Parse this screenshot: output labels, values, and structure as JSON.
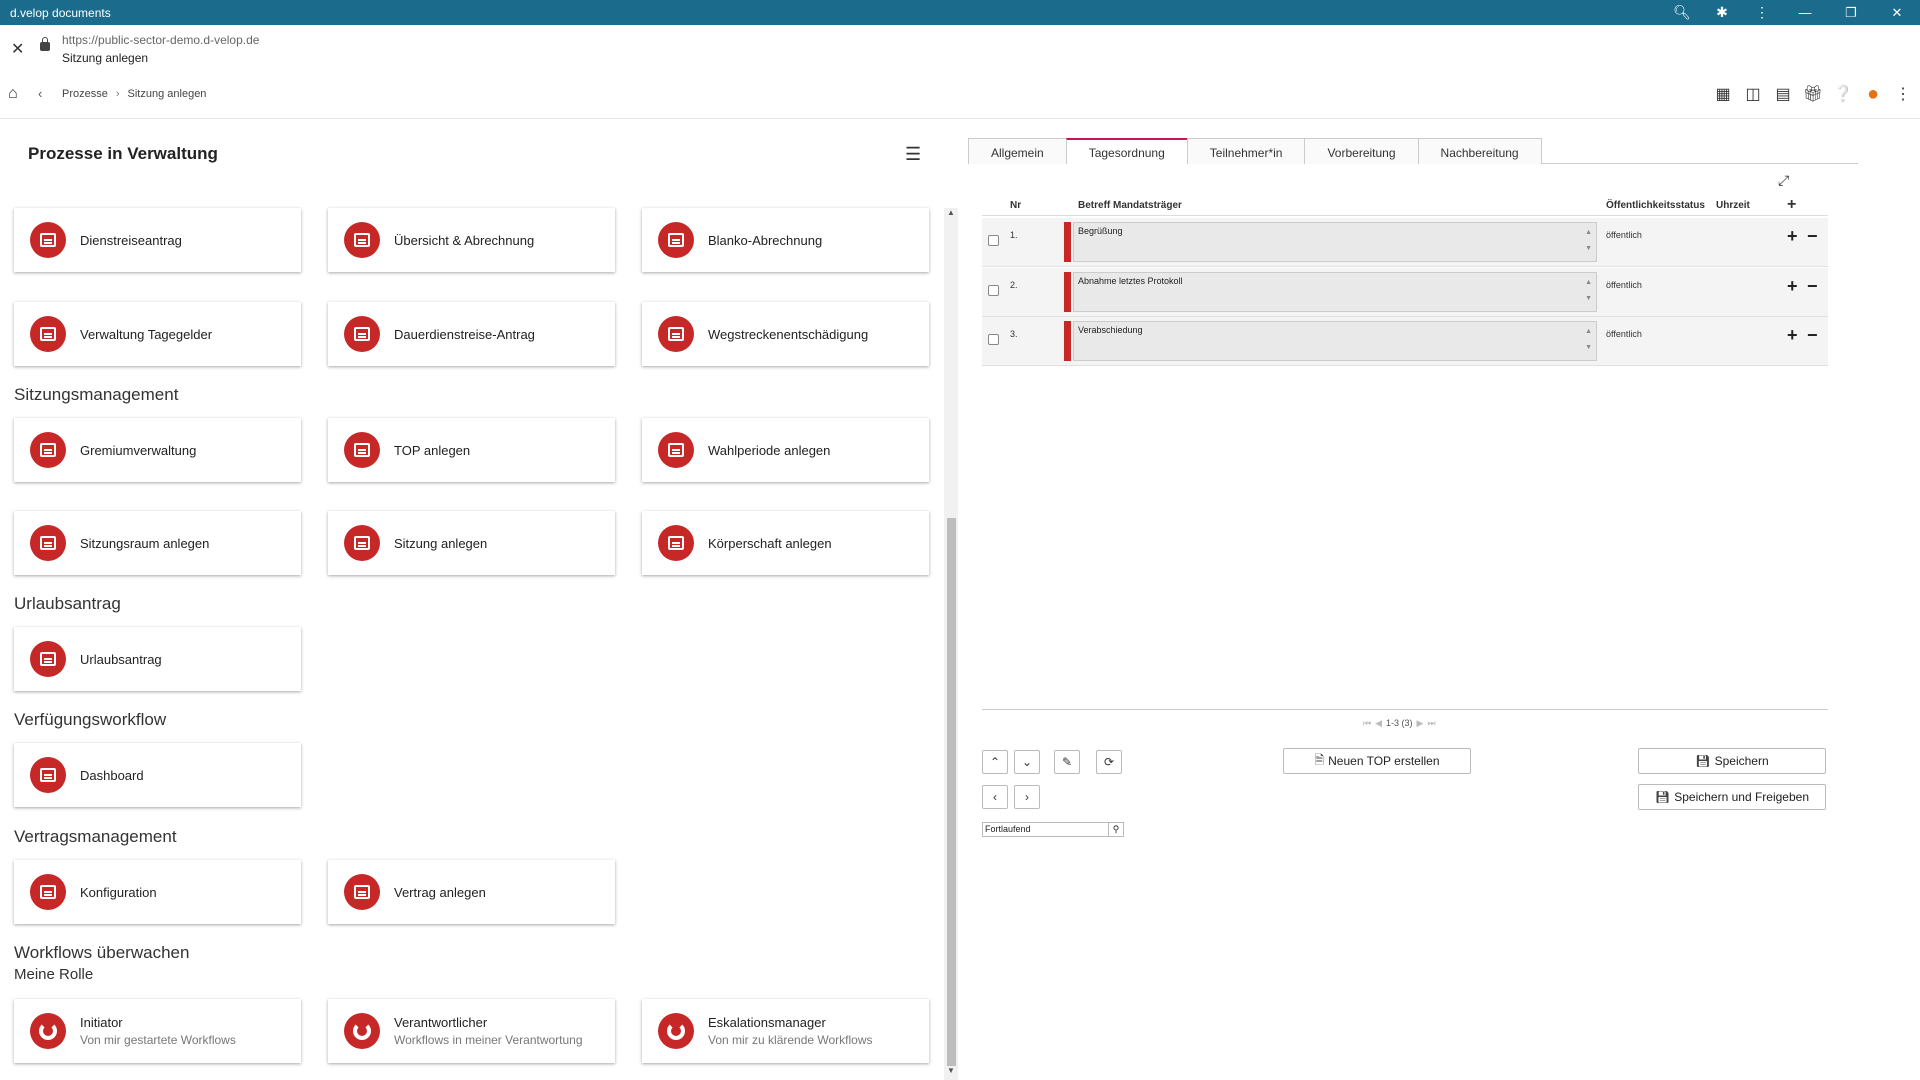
{
  "window": {
    "title": "d.velop documents"
  },
  "urlbar": {
    "url": "https://public-sector-demo.d-velop.de",
    "page_title": "Sitzung anlegen"
  },
  "breadcrumb": {
    "items": [
      "Prozesse",
      "Sitzung anlegen"
    ]
  },
  "left": {
    "title": "Prozesse in Verwaltung",
    "tiles": [
      {
        "label": "Dienstreiseantrag"
      },
      {
        "label": "Übersicht & Abrechnung"
      },
      {
        "label": "Blanko-Abrechnung"
      },
      {
        "label": "Verwaltung Tagegelder"
      },
      {
        "label": "Dauerdienstreise-Antrag"
      },
      {
        "label": "Wegstreckenentschädigung"
      }
    ],
    "sections": [
      {
        "title": "Sitzungsmanagement",
        "tiles": [
          {
            "label": "Gremiumverwaltung"
          },
          {
            "label": "TOP anlegen"
          },
          {
            "label": "Wahlperiode anlegen"
          },
          {
            "label": "Sitzungsraum anlegen"
          },
          {
            "label": "Sitzung anlegen"
          },
          {
            "label": "Körperschaft anlegen"
          }
        ]
      },
      {
        "title": "Urlaubsantrag",
        "tiles": [
          {
            "label": "Urlaubsantrag"
          }
        ]
      },
      {
        "title": "Verfügungsworkflow",
        "tiles": [
          {
            "label": "Dashboard"
          }
        ]
      },
      {
        "title": "Vertragsmanagement",
        "tiles": [
          {
            "label": "Konfiguration"
          },
          {
            "label": "Vertrag anlegen"
          }
        ]
      },
      {
        "title": "Workflows überwachen",
        "subtitle": "Meine Rolle",
        "tiles": [
          {
            "label": "Initiator",
            "sub": "Von mir gestartete Workflows"
          },
          {
            "label": "Verantwortlicher",
            "sub": "Workflows in meiner Verantwortung"
          },
          {
            "label": "Eskalationsmanager",
            "sub": "Von mir zu klärende Workflows"
          }
        ]
      }
    ]
  },
  "right": {
    "tabs": [
      "Allgemein",
      "Tagesordnung",
      "Teilnehmer*in",
      "Vorbereitung",
      "Nachbereitung"
    ],
    "active_tab": "Tagesordnung",
    "grid": {
      "headers": {
        "nr": "Nr",
        "betreff": "Betreff Mandatsträger",
        "status": "Öffentlichkeitsstatus",
        "uhrzeit": "Uhrzeit"
      },
      "rows": [
        {
          "nr": "1.",
          "betreff": "Begrüßung",
          "status": "öffentlich"
        },
        {
          "nr": "2.",
          "betreff": "Abnahme letztes Protokoll",
          "status": "öffentlich"
        },
        {
          "nr": "3.",
          "betreff": "Verabschiedung",
          "status": "öffentlich"
        }
      ]
    },
    "pager": "1-3 (3)",
    "buttons": {
      "new_top": "Neuen TOP erstellen",
      "save": "Speichern",
      "save_release": "Speichern und Freigeben"
    },
    "search_value": "Fortlaufend"
  },
  "colors": {
    "titlebar": "#1b6c8c",
    "accent_red": "#c62828",
    "tab_active": "#c2185b",
    "avatar": "#e07414"
  }
}
